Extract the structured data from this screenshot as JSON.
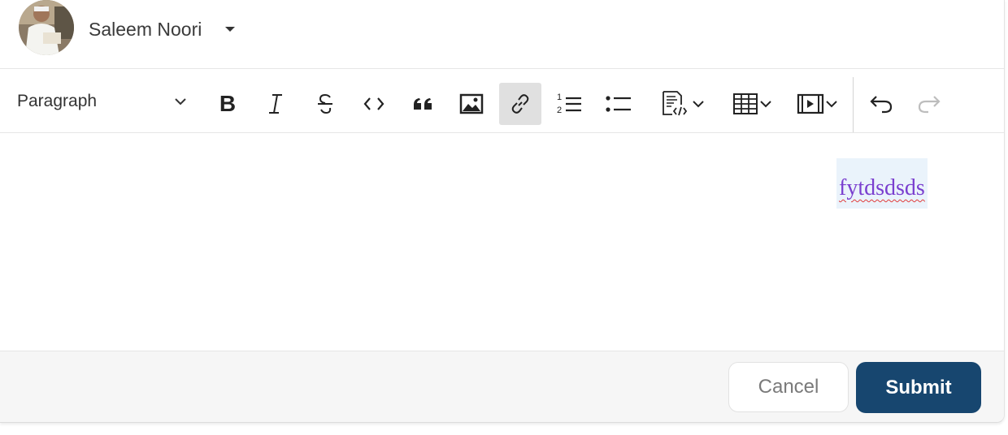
{
  "header": {
    "user_name": "Saleem Noori"
  },
  "toolbar": {
    "block_format": "Paragraph",
    "buttons": [
      {
        "icon": "bold-icon"
      },
      {
        "icon": "italic-icon"
      },
      {
        "icon": "strikethrough-icon"
      },
      {
        "icon": "code-icon"
      },
      {
        "icon": "blockquote-icon"
      },
      {
        "icon": "image-icon"
      },
      {
        "icon": "link-icon",
        "active": true
      },
      {
        "icon": "numbered-list-icon"
      },
      {
        "icon": "bulleted-list-icon"
      },
      {
        "icon": "code-block-icon",
        "has_dropdown": true
      },
      {
        "icon": "table-icon",
        "has_dropdown": true
      },
      {
        "icon": "media-icon",
        "has_dropdown": true
      },
      {
        "icon": "undo-icon"
      },
      {
        "icon": "redo-icon",
        "disabled": true
      }
    ]
  },
  "editor": {
    "content": "fytdsdsds"
  },
  "footer": {
    "cancel_label": "Cancel",
    "submit_label": "Submit"
  },
  "colors": {
    "submit_bg": "#17466f",
    "link_text": "#7a3fcf",
    "selection_bg": "#eaf3fb",
    "active_button_bg": "#e0e0e0"
  }
}
